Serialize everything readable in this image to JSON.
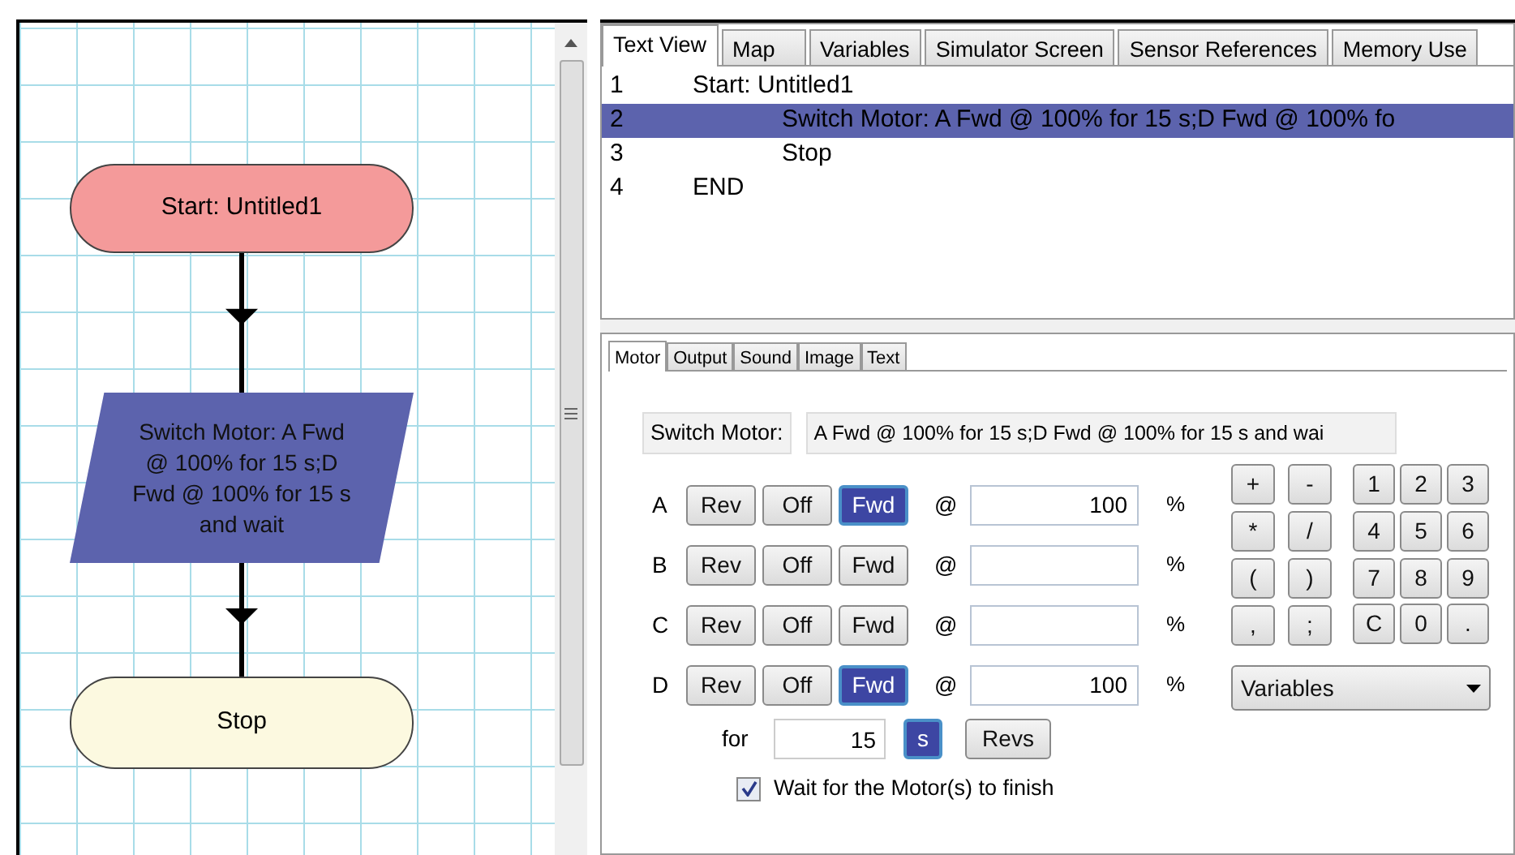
{
  "flowchart": {
    "nodes": [
      {
        "kind": "start",
        "text": "Start: Untitled1",
        "selected": false
      },
      {
        "kind": "process",
        "text": "Switch Motor: A Fwd @ 100% for 15 s;D Fwd @ 100% for 15 s and wait",
        "selected": true
      },
      {
        "kind": "stop",
        "text": "Stop",
        "selected": false
      }
    ]
  },
  "view_tabs": [
    {
      "label": "Text View",
      "selected": true
    },
    {
      "label": "Map",
      "selected": false
    },
    {
      "label": "Variables",
      "selected": false
    },
    {
      "label": "Simulator Screen",
      "selected": false
    },
    {
      "label": "Sensor References",
      "selected": false
    },
    {
      "label": "Memory Use",
      "selected": false
    }
  ],
  "text_view": [
    {
      "number": "1",
      "text": "Start: Untitled1",
      "selected": false,
      "children": [
        {
          "number": "2",
          "text": "Switch Motor: A Fwd @ 100% for 15 s;D Fwd @ 100% fo",
          "selected": true
        },
        {
          "number": "3",
          "text": "Stop",
          "selected": false
        }
      ]
    },
    {
      "number": "4",
      "text": "END",
      "selected": false
    }
  ],
  "property_tabs": [
    {
      "label": "Motor",
      "selected": true
    },
    {
      "label": "Output",
      "selected": false
    },
    {
      "label": "Sound",
      "selected": false
    },
    {
      "label": "Image",
      "selected": false
    },
    {
      "label": "Text",
      "selected": false
    }
  ],
  "command": {
    "label": "Switch Motor:",
    "value": "A Fwd @ 100% for 15 s;D Fwd @ 100% for 15 s and wai"
  },
  "motors": [
    {
      "name": "A",
      "buttons": [
        {
          "label": "Rev",
          "selected": false
        },
        {
          "label": "Off",
          "selected": false
        },
        {
          "label": "Fwd",
          "selected": true
        }
      ],
      "at": "@",
      "power": "100",
      "unit": "%"
    },
    {
      "name": "B",
      "buttons": [
        {
          "label": "Rev",
          "selected": false
        },
        {
          "label": "Off",
          "selected": false
        },
        {
          "label": "Fwd",
          "selected": false
        }
      ],
      "at": "@",
      "unit": "%"
    },
    {
      "name": "C",
      "buttons": [
        {
          "label": "Rev",
          "selected": false
        },
        {
          "label": "Off",
          "selected": false
        },
        {
          "label": "Fwd",
          "selected": false
        }
      ],
      "at": "@",
      "unit": "%"
    },
    {
      "name": "D",
      "buttons": [
        {
          "label": "Rev",
          "selected": false
        },
        {
          "label": "Off",
          "selected": false
        },
        {
          "label": "Fwd",
          "selected": true
        }
      ],
      "at": "@",
      "power": "100",
      "unit": "%"
    }
  ],
  "duration": {
    "label": "for",
    "value": "15",
    "units": [
      {
        "label": "s",
        "selected": true
      },
      {
        "label": "Revs",
        "selected": false
      }
    ]
  },
  "wait": {
    "label": "Wait for the Motor(s) to finish",
    "checked": true
  },
  "operator_keys": [
    "+",
    "-",
    "*",
    "/",
    "(",
    ")",
    ",",
    ";"
  ],
  "number_keys": [
    "1",
    "2",
    "3",
    "4",
    "5",
    "6",
    "7",
    "8",
    "9",
    "C",
    "0",
    "."
  ],
  "variables_dropdown": {
    "value": "Variables"
  }
}
